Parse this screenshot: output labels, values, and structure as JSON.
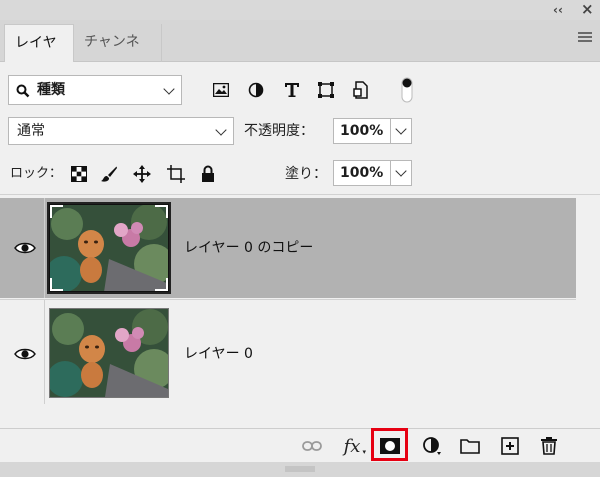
{
  "titlebar": {
    "collapse_glyph": "‹‹",
    "close_glyph": "×"
  },
  "tabs": [
    {
      "label": "レイヤー",
      "active": true
    },
    {
      "label": "チャンネル",
      "active": false
    }
  ],
  "filter": {
    "kind_label": "種類",
    "icons": [
      "image-filter-icon",
      "adjustment-filter-icon",
      "type-filter-icon",
      "shape-filter-icon",
      "smart-object-filter-icon",
      "filter-toggle-icon"
    ]
  },
  "blend": {
    "mode": "通常",
    "opacity_label": "不透明度：",
    "opacity_value": "100%"
  },
  "lock": {
    "label": "ロック：",
    "icons": [
      "lock-transparent-pixels-icon",
      "lock-image-pixels-icon",
      "lock-position-icon",
      "lock-artboard-icon",
      "lock-all-icon"
    ],
    "fill_label": "塗り：",
    "fill_value": "100%"
  },
  "layers": [
    {
      "name": "レイヤー 0 のコピー",
      "selected": true,
      "visible": true
    },
    {
      "name": "レイヤー 0",
      "selected": false,
      "visible": true
    }
  ],
  "bottom": {
    "fx_label": "fx",
    "icons": [
      "link-layers-icon",
      "fx-icon",
      "add-mask-icon",
      "adjustment-layer-icon",
      "group-folder-icon",
      "new-layer-icon",
      "trash-icon"
    ],
    "highlight_color": "#e60012"
  },
  "colors": {
    "panel_bg": "#f0f0f0",
    "selected_row": "#b2b2b2",
    "chrome": "#d6d6d6"
  }
}
